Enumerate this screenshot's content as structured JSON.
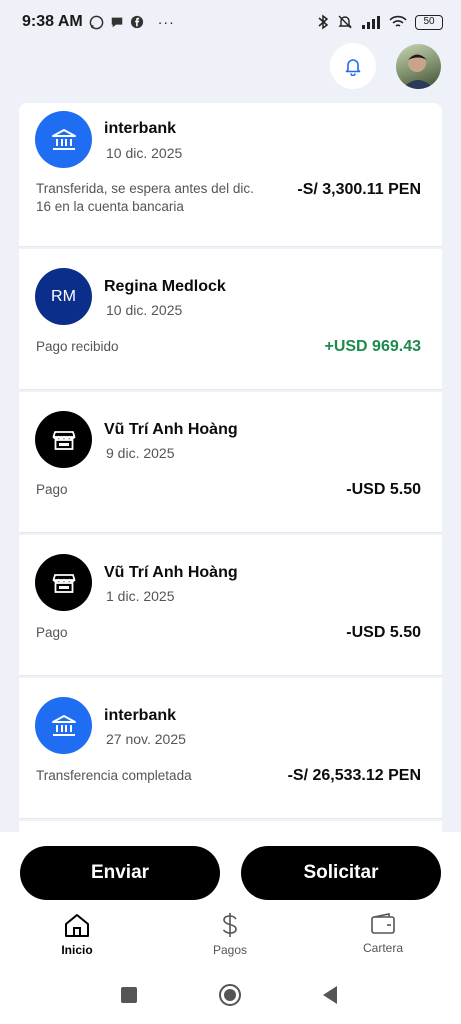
{
  "status_bar": {
    "time": "9:38 AM",
    "overflow": "···",
    "battery": "50"
  },
  "header": {
    "bell_icon": "bell-icon",
    "avatar": "profile-avatar"
  },
  "transactions": [
    {
      "icon": "bank-icon",
      "icon_color": "#1f6df2",
      "name": "interbank",
      "date": "10 dic. 2025",
      "description": "Transferida, se espera antes del dic. 16 en la cuenta bancaria",
      "amount": "-S/ 3,300.11 PEN",
      "positive": false
    },
    {
      "icon": "initials",
      "icon_color": "#0b2e8a",
      "initials": "RM",
      "name": "Regina Medlock",
      "date": "10 dic. 2025",
      "description": "Pago recibido",
      "amount": "+USD 969.43",
      "positive": true
    },
    {
      "icon": "store-icon",
      "icon_color": "#000000",
      "name": "Vũ Trí Anh Hoàng",
      "date": "9 dic. 2025",
      "description": "Pago",
      "amount": "-USD 5.50",
      "positive": false
    },
    {
      "icon": "store-icon",
      "icon_color": "#000000",
      "name": "Vũ Trí Anh Hoàng",
      "date": "1 dic. 2025",
      "description": "Pago",
      "amount": "-USD 5.50",
      "positive": false
    },
    {
      "icon": "bank-icon",
      "icon_color": "#1f6df2",
      "name": "interbank",
      "date": "27 nov. 2025",
      "description": "Transferencia completada",
      "amount": "-S/ 26,533.12 PEN",
      "positive": false
    }
  ],
  "actions": {
    "send": "Enviar",
    "request": "Solicitar"
  },
  "bottom_nav": [
    {
      "label": "Inicio",
      "icon": "home-icon",
      "active": true
    },
    {
      "label": "Pagos",
      "icon": "dollar-icon",
      "active": false
    },
    {
      "label": "Cartera",
      "icon": "wallet-icon",
      "active": false
    }
  ],
  "colors": {
    "background": "#eef1f8",
    "accent_blue": "#1f6df2",
    "positive_green": "#1e8a4d"
  }
}
